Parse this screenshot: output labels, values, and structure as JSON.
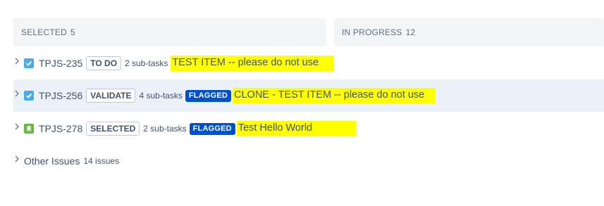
{
  "columns": [
    {
      "label": "SELECTED",
      "count": "5"
    },
    {
      "label": "IN PROGRESS",
      "count": "12"
    }
  ],
  "issues": [
    {
      "key": "TPJS-235",
      "status": "TO DO",
      "subtasks": "2 sub-tasks",
      "flag": "",
      "summary": "TEST ITEM -- please do not use",
      "type_icon": "task-checkbox-icon"
    },
    {
      "key": "TPJS-256",
      "status": "VALIDATE",
      "subtasks": "4 sub-tasks",
      "flag": "FLAGGED",
      "summary": "CLONE - TEST ITEM -- please do not use",
      "type_icon": "task-checkbox-icon"
    },
    {
      "key": "TPJS-278",
      "status": "SELECTED",
      "subtasks": "2 sub-tasks",
      "flag": "FLAGGED",
      "summary": "Test Hello World",
      "type_icon": "story-bookmark-icon"
    }
  ],
  "other_issues": {
    "label": "Other Issues",
    "count": "14 issues"
  },
  "colors": {
    "highlight": "#ffff00",
    "flag_bg": "#0052cc",
    "task_icon": "#4bade8",
    "story_icon": "#63ba3c",
    "selected_row_bg": "#ebf1f9"
  }
}
